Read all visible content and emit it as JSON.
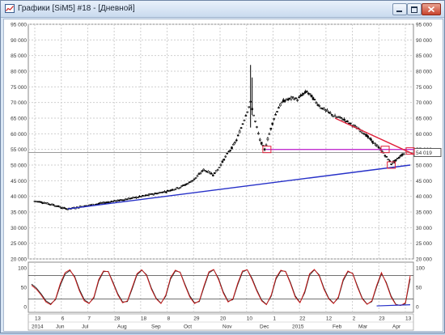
{
  "window": {
    "title": "Графики [SiM5] #18 - [Дневной]",
    "icon": "chart-app-icon",
    "buttons": [
      "minimize-icon",
      "maximize-icon",
      "close-icon"
    ]
  },
  "colors": {
    "candle": "#000000",
    "trend_support": "#2630c8",
    "trend_resistance": "#e0203a",
    "level_line": "#c230d0",
    "price_line": "#9a9a9a",
    "osc_k": "#d21919",
    "osc_d": "#222222",
    "grid": "#cfcfcf"
  },
  "price_axis": {
    "ticks": [
      "95 000",
      "90 000",
      "85 000",
      "80 000",
      "75 000",
      "70 000",
      "65 000",
      "60 000",
      "55 000",
      "50 000",
      "45 000",
      "40 000",
      "35 000",
      "30 000",
      "25 000",
      "20 000"
    ],
    "current_price": "54 019"
  },
  "osc_axis": {
    "ticks": [
      "100",
      "50",
      "0"
    ]
  },
  "x_axis": {
    "days": [
      "13",
      "6",
      "7",
      "28",
      "18",
      "8",
      "29",
      "20",
      "10",
      "1",
      "22",
      "12",
      "2",
      "23",
      "13"
    ],
    "months": [
      "2014",
      "Jun",
      "Jul",
      "Aug",
      "Sep",
      "Oct",
      "Nov",
      "Dec",
      "2015",
      "Feb",
      "Mar",
      "Apr"
    ]
  },
  "chart_data": [
    {
      "type": "candlestick",
      "title": "",
      "ylim": [
        20000,
        95000
      ],
      "levels": [
        {
          "type": "horizontal",
          "y": 55000
        },
        {
          "type": "current",
          "y": 54019
        }
      ],
      "trendlines": [
        {
          "from": [
            "Jul",
            "36000"
          ],
          "to": [
            "Apr",
            "50000"
          ]
        },
        {
          "from": [
            "Mar",
            "65000"
          ],
          "to": [
            "Apr",
            "54000"
          ]
        }
      ],
      "series": [
        {
          "x": [
            "13",
            "20",
            "27",
            "3",
            "10",
            "17",
            "24",
            "1",
            "8",
            "15",
            "22",
            "29",
            "6",
            "13",
            "20",
            "27",
            "3",
            "10",
            "17",
            "24",
            "31",
            "7",
            "14",
            "21",
            "28",
            "4",
            "11",
            "18",
            "25",
            "1",
            "8",
            "15",
            "22",
            "29",
            "6",
            "13",
            "20",
            "27",
            "3",
            "10",
            "17",
            "24",
            "1",
            "8",
            "15",
            "22",
            "29",
            "6",
            "13",
            "20",
            "27",
            "3",
            "10",
            "17",
            "24",
            "31",
            "7",
            "14",
            "21",
            "28",
            "7",
            "14",
            "21",
            "28",
            "4",
            "11",
            "18",
            "25",
            "2",
            "9",
            "16",
            "23",
            "2",
            "9",
            "16",
            "23",
            "30",
            "6",
            "13",
            "20"
          ],
          "values": [
            38500,
            38300,
            38000,
            37600,
            37300,
            36800,
            36300,
            36000,
            36200,
            36500,
            36800,
            37000,
            37300,
            37500,
            37800,
            38000,
            38300,
            38500,
            38700,
            39000,
            39300,
            39500,
            39800,
            40100,
            40400,
            40700,
            41000,
            41300,
            41600,
            42000,
            42500,
            43000,
            43700,
            44500,
            45500,
            47000,
            48500,
            47800,
            47000,
            48500,
            51000,
            53500,
            55500,
            58000,
            62000,
            66000,
            70000,
            64000,
            58000,
            55000,
            60000,
            65000,
            68500,
            70500,
            71000,
            71500,
            71000,
            72500,
            73500,
            72000,
            70000,
            68500,
            67500,
            66500,
            65500,
            65200,
            64500,
            63500,
            62500,
            61500,
            60500,
            59000,
            57500,
            56000,
            54500,
            52500,
            50500,
            51500,
            53000,
            54019
          ]
        }
      ]
    },
    {
      "type": "line",
      "title": "",
      "ylim": [
        0,
        100
      ],
      "levels": [
        20,
        80
      ],
      "series": [
        {
          "values": [
            55,
            45,
            30,
            12,
            5,
            20,
            60,
            88,
            95,
            75,
            40,
            15,
            8,
            25,
            70,
            92,
            90,
            60,
            30,
            10,
            15,
            50,
            85,
            95,
            80,
            45,
            20,
            8,
            30,
            75,
            94,
            88,
            55,
            25,
            8,
            15,
            55,
            90,
            96,
            70,
            35,
            12,
            20,
            60,
            92,
            95,
            70,
            40,
            15,
            5,
            30,
            75,
            94,
            90,
            60,
            25,
            10,
            40,
            85,
            96,
            80,
            45,
            20,
            8,
            25,
            70,
            92,
            85,
            50,
            20,
            6,
            15,
            55,
            88,
            60,
            25,
            5,
            3,
            10,
            80
          ]
        },
        {
          "values": [
            58,
            48,
            33,
            15,
            7,
            18,
            55,
            84,
            93,
            78,
            44,
            18,
            9,
            22,
            66,
            90,
            91,
            63,
            33,
            12,
            13,
            46,
            82,
            94,
            82,
            48,
            22,
            9,
            27,
            71,
            92,
            89,
            58,
            28,
            10,
            13,
            51,
            87,
            95,
            73,
            38,
            14,
            18,
            56,
            89,
            95,
            73,
            43,
            17,
            6,
            27,
            71,
            92,
            91,
            63,
            28,
            11,
            36,
            81,
            95,
            82,
            48,
            22,
            9,
            22,
            66,
            90,
            86,
            53,
            22,
            7,
            13,
            51,
            85,
            63,
            28,
            6,
            3,
            8,
            72
          ]
        }
      ]
    }
  ]
}
